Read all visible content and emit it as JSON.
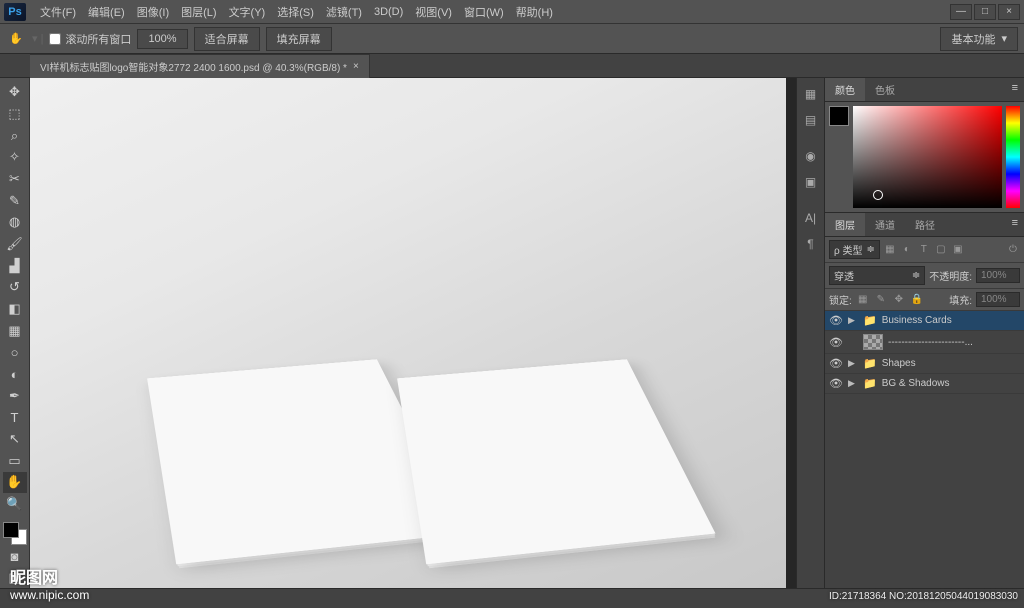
{
  "app": {
    "logo_text": "Ps"
  },
  "menu": {
    "file": "文件(F)",
    "edit": "编辑(E)",
    "image": "图像(I)",
    "layer": "图层(L)",
    "type": "文字(Y)",
    "select": "选择(S)",
    "filter": "滤镜(T)",
    "threed": "3D(D)",
    "view": "视图(V)",
    "window": "窗口(W)",
    "help": "帮助(H)"
  },
  "window_controls": {
    "min": "—",
    "max": "□",
    "close": "×"
  },
  "options": {
    "scroll_all": "滚动所有窗口",
    "zoom": "100%",
    "fit": "适合屏幕",
    "fill": "填充屏幕",
    "workspace": "基本功能"
  },
  "tab": {
    "title": "VI样机标志贴图logo智能对象2772 2400 1600.psd @ 40.3%(RGB/8) *",
    "close": "×"
  },
  "color_panel": {
    "tab1": "颜色",
    "tab2": "色板"
  },
  "layers_panel": {
    "tab1": "图层",
    "tab2": "通道",
    "tab3": "路径",
    "kind_label": "ρ 类型",
    "blend_mode": "穿透",
    "opacity_label": "不透明度:",
    "opacity_value": "100%",
    "lock_label": "锁定:",
    "fill_label": "填充:",
    "fill_value": "100%"
  },
  "layers": [
    {
      "name": "Business Cards",
      "type": "folder",
      "selected": true
    },
    {
      "name": "-----------------------...",
      "type": "layer",
      "selected": false
    },
    {
      "name": "Shapes",
      "type": "folder",
      "selected": false
    },
    {
      "name": "BG & Shadows",
      "type": "folder",
      "selected": false
    }
  ],
  "watermark": {
    "brand": "昵图网",
    "url": "www.nipic.com",
    "id": "ID:21718364 NO:20181205044019083030"
  }
}
